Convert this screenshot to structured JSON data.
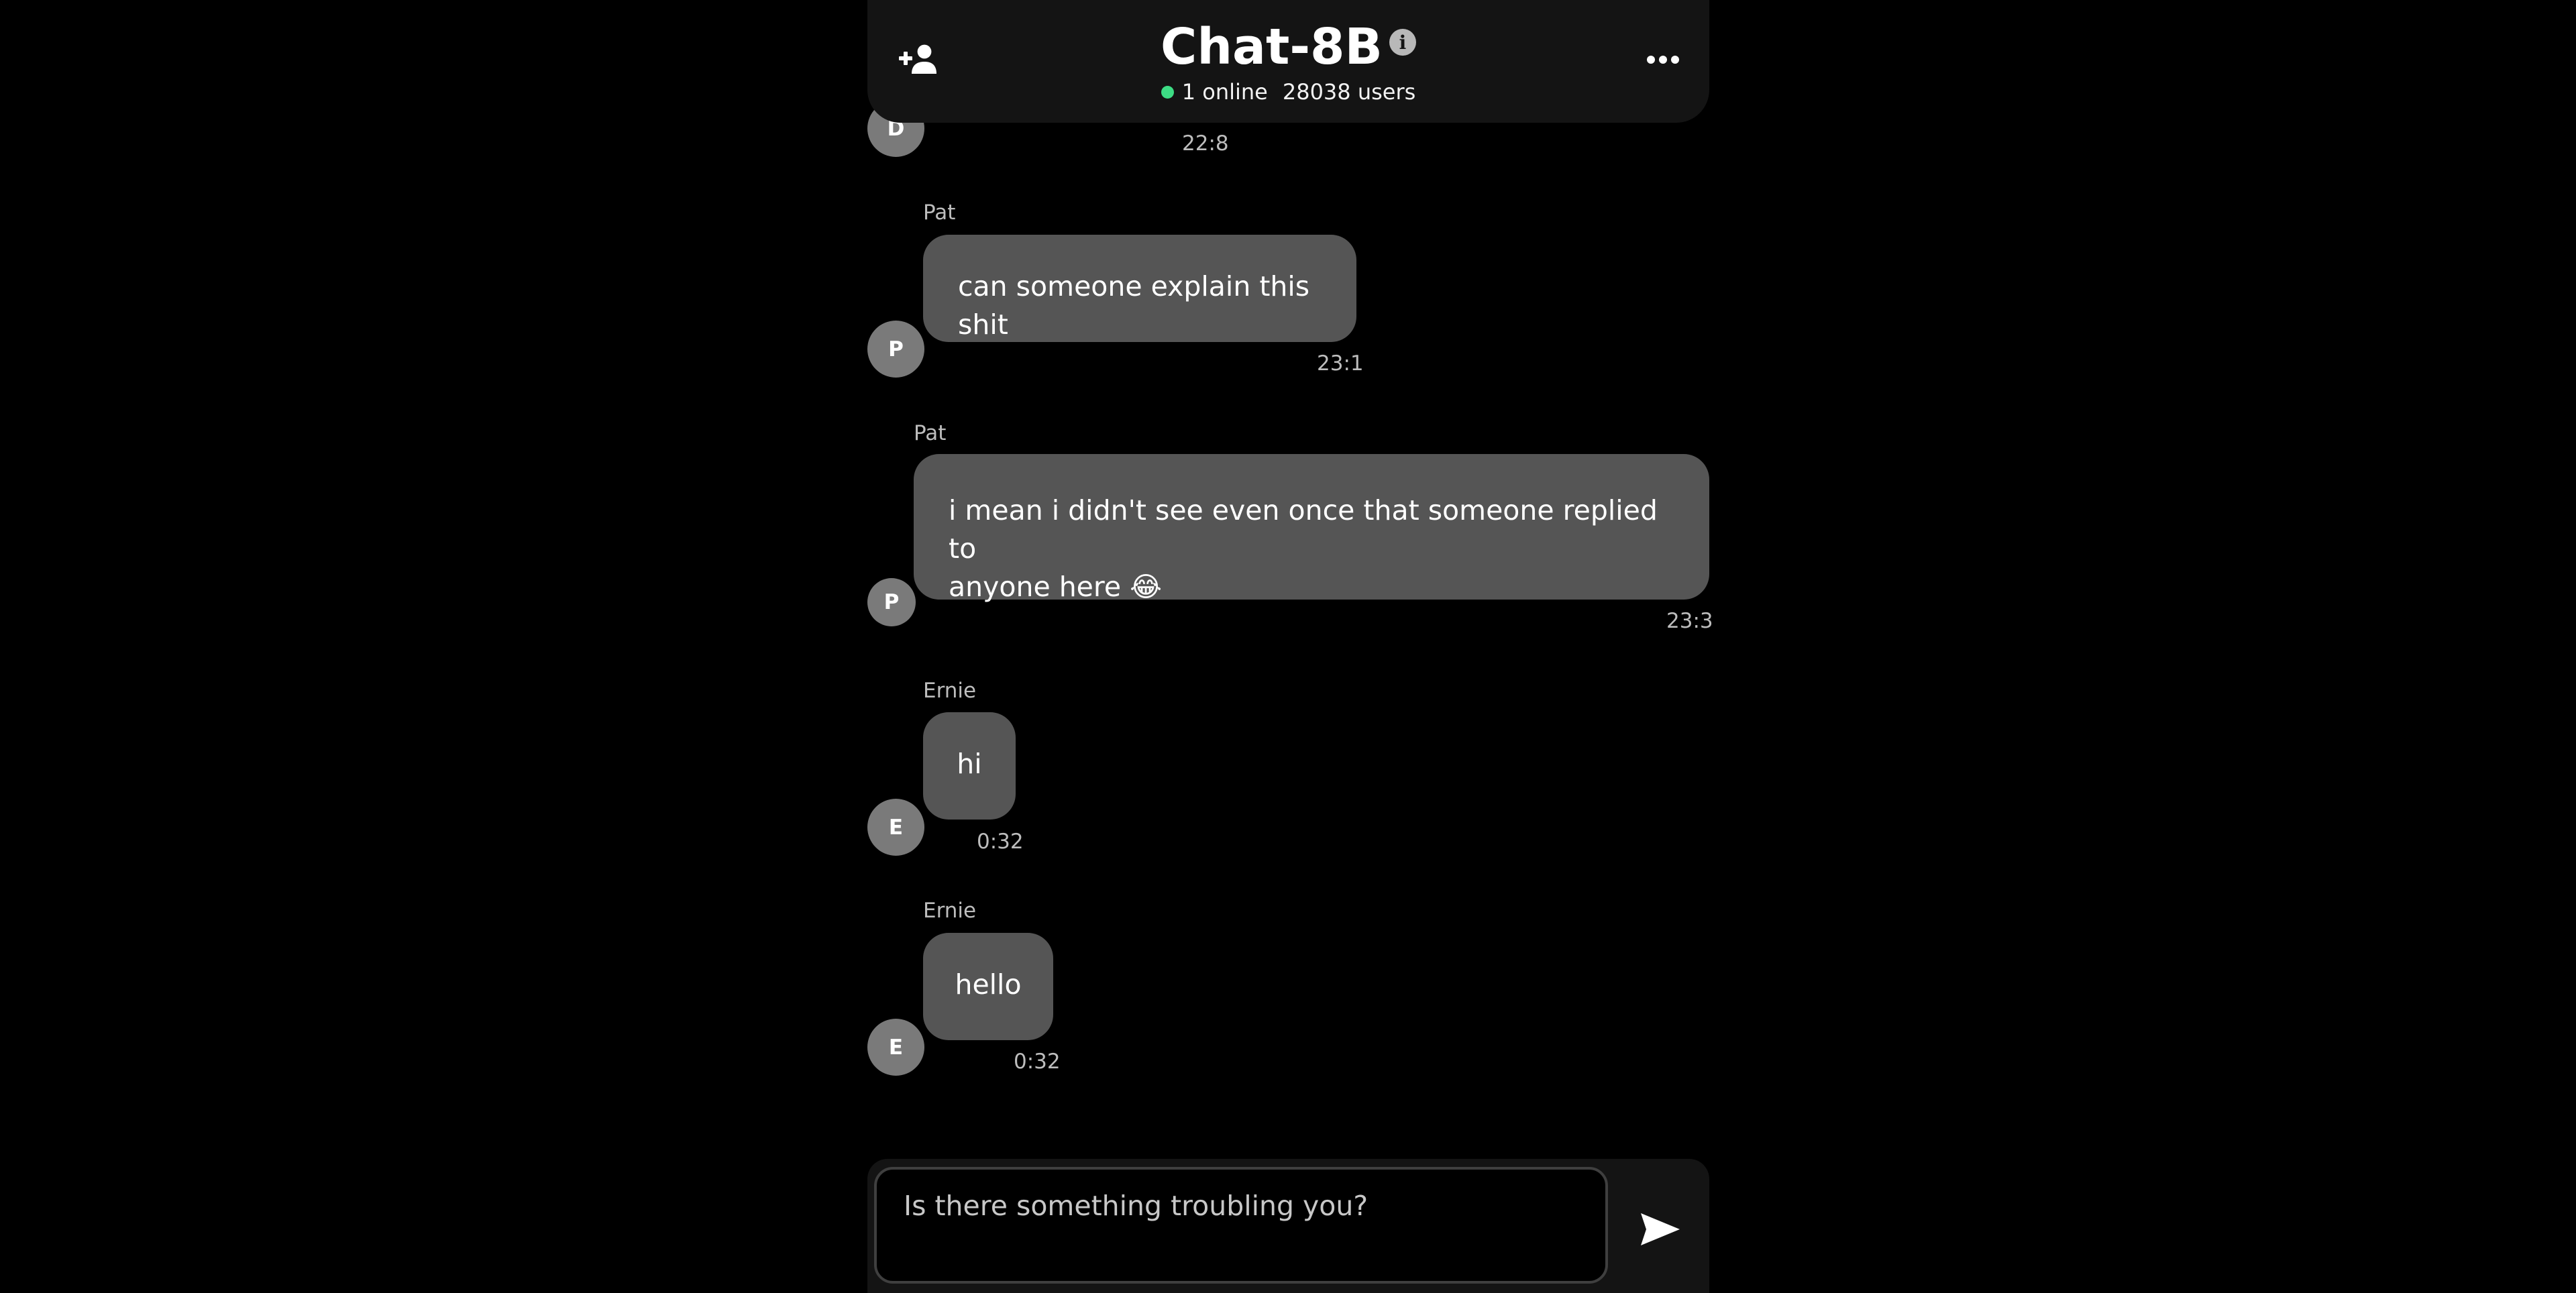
{
  "header": {
    "title": "Chat-8B",
    "info_glyph": "i",
    "online_text": "1 online",
    "users_text": "28038 users",
    "online_color": "#3ddc84",
    "add_user_icon": "add-user-icon",
    "more_icon": "more-horizontal-icon"
  },
  "messages": [
    {
      "avatar": "D",
      "time": "22:8"
    },
    {
      "sender": "Pat",
      "avatar": "P",
      "text": "can someone explain this shit",
      "time": "23:1"
    },
    {
      "sender": "Pat",
      "avatar": "P",
      "text_line1": "i mean i didn't see even once that someone replied to",
      "text_line2": "anyone here 😂",
      "time": "23:3"
    },
    {
      "sender": "Ernie",
      "avatar": "E",
      "text": "hi",
      "time": "0:32"
    },
    {
      "sender": "Ernie",
      "avatar": "E",
      "text": "hello",
      "time": "0:32"
    }
  ],
  "composer": {
    "placeholder": "Is there something troubling you?",
    "send_icon": "send-icon"
  }
}
